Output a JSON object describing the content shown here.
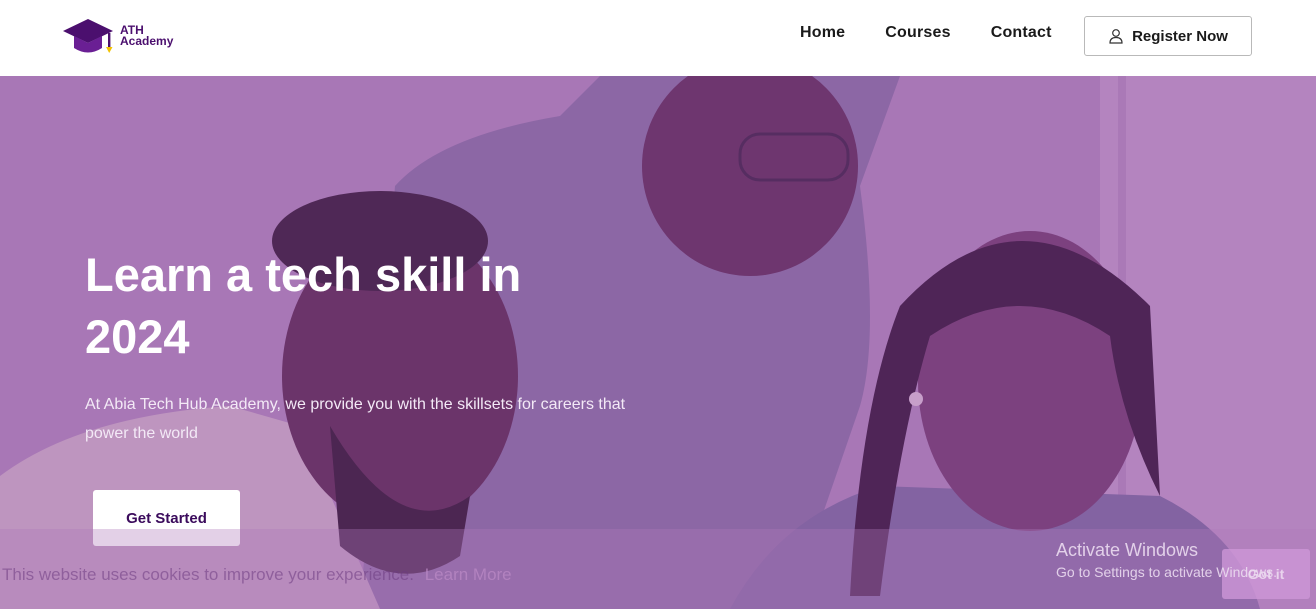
{
  "brand": {
    "line1": "ATH",
    "line2": "Academy"
  },
  "nav": {
    "links": [
      "Home",
      "Courses",
      "Contact"
    ],
    "register_label": "Register Now"
  },
  "hero": {
    "title": "Learn a tech skill in 2024",
    "text": "At Abia Tech Hub Academy, we provide you with the skillsets for careers that power the world",
    "cta_label": "Get Started"
  },
  "cookie": {
    "text": "This website uses cookies to improve your experience.",
    "link": "Learn More",
    "accept_label": "Got it"
  },
  "windows_notice": {
    "title": "Activate Windows",
    "subtitle": "Go to Settings to activate Windows."
  },
  "colors": {
    "brand_purple": "#4b0f6e",
    "hero_overlay": "#8c46a0",
    "cta_text": "#3b0b5c"
  }
}
